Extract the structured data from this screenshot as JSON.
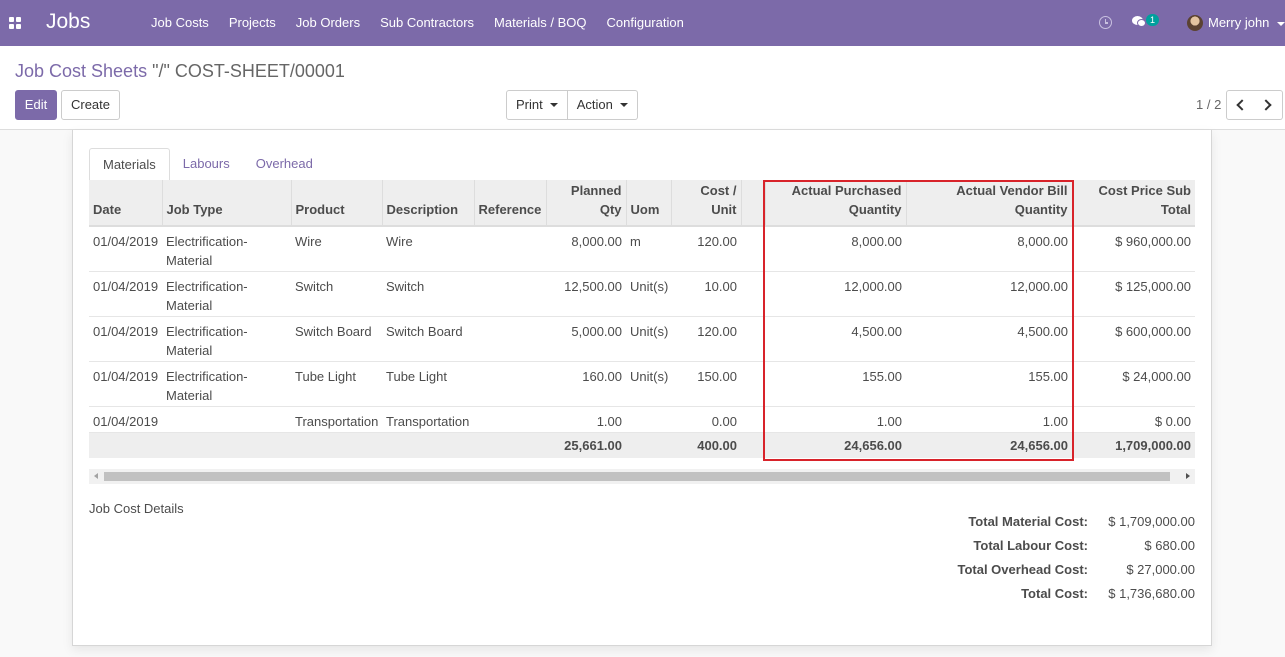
{
  "navbar": {
    "brand": "Jobs",
    "menu": [
      "Job Costs",
      "Projects",
      "Job Orders",
      "Sub Contractors",
      "Materials / BOQ",
      "Configuration"
    ],
    "chat_count": "1",
    "user_name": "Merry john",
    "icons": [
      "apps-icon",
      "clock-icon",
      "chat-icon",
      "avatar",
      "caret-down-icon"
    ],
    "accent_color": "#7c6aa9"
  },
  "control_panel": {
    "breadcrumb_parent": "Job Cost Sheets",
    "breadcrumb_current": "\"/\" COST-SHEET/00001",
    "edit_label": "Edit",
    "create_label": "Create",
    "print_label": "Print",
    "action_label": "Action",
    "pager": "1 / 2"
  },
  "tabs": [
    {
      "label": "Materials",
      "active": true
    },
    {
      "label": "Labours",
      "active": false
    },
    {
      "label": "Overhead",
      "active": false
    }
  ],
  "materials_table": {
    "headers": {
      "date": "Date",
      "job_type": "Job Type",
      "product": "Product",
      "description": "Description",
      "reference": "Reference",
      "planned_qty_1": "Planned",
      "planned_qty_2": "Qty",
      "uom": "Uom",
      "cost_unit_1": "Cost /",
      "cost_unit_2": "Unit",
      "actual_purchased_1": "Actual Purchased",
      "actual_purchased_2": "Quantity",
      "actual_vendor_bill_1": "Actual Vendor Bill",
      "actual_vendor_bill_2": "Quantity",
      "subtotal_1": "Cost Price Sub",
      "subtotal_2": "Total"
    },
    "rows": [
      {
        "date": "01/04/2019",
        "job_type": "Electrification-Material",
        "product": "Wire",
        "description": "Wire",
        "reference": "",
        "planned_qty": "8,000.00",
        "uom": "m",
        "cost_unit": "120.00",
        "actual_purchased": "8,000.00",
        "actual_vendor_bill": "8,000.00",
        "subtotal": "$ 960,000.00"
      },
      {
        "date": "01/04/2019",
        "job_type": "Electrification-Material",
        "product": "Switch",
        "description": "Switch",
        "reference": "",
        "planned_qty": "12,500.00",
        "uom": "Unit(s)",
        "cost_unit": "10.00",
        "actual_purchased": "12,000.00",
        "actual_vendor_bill": "12,000.00",
        "subtotal": "$ 125,000.00"
      },
      {
        "date": "01/04/2019",
        "job_type": "Electrification-Material",
        "product": "Switch Board",
        "description": "Switch Board",
        "reference": "",
        "planned_qty": "5,000.00",
        "uom": "Unit(s)",
        "cost_unit": "120.00",
        "actual_purchased": "4,500.00",
        "actual_vendor_bill": "4,500.00",
        "subtotal": "$ 600,000.00"
      },
      {
        "date": "01/04/2019",
        "job_type": "Electrification-Material",
        "product": "Tube Light",
        "description": "Tube Light",
        "reference": "",
        "planned_qty": "160.00",
        "uom": "Unit(s)",
        "cost_unit": "150.00",
        "actual_purchased": "155.00",
        "actual_vendor_bill": "155.00",
        "subtotal": "$ 24,000.00"
      },
      {
        "date": "01/04/2019",
        "job_type": "",
        "product": "Transportation",
        "description": "Transportation",
        "reference": "",
        "planned_qty": "1.00",
        "uom": "",
        "cost_unit": "0.00",
        "actual_purchased": "1.00",
        "actual_vendor_bill": "1.00",
        "subtotal": "$ 0.00"
      }
    ],
    "footer": {
      "planned_qty": "25,661.00",
      "cost_unit": "400.00",
      "actual_purchased": "24,656.00",
      "actual_vendor_bill": "24,656.00",
      "subtotal": "1,709,000.00"
    },
    "highlight_color": "#d8232a"
  },
  "details": {
    "label": "Job Cost Details",
    "totals": [
      {
        "label": "Total Material Cost:",
        "value": "$ 1,709,000.00"
      },
      {
        "label": "Total Labour Cost:",
        "value": "$ 680.00"
      },
      {
        "label": "Total Overhead Cost:",
        "value": "$ 27,000.00"
      },
      {
        "label": "Total Cost:",
        "value": "$ 1,736,680.00"
      }
    ]
  }
}
